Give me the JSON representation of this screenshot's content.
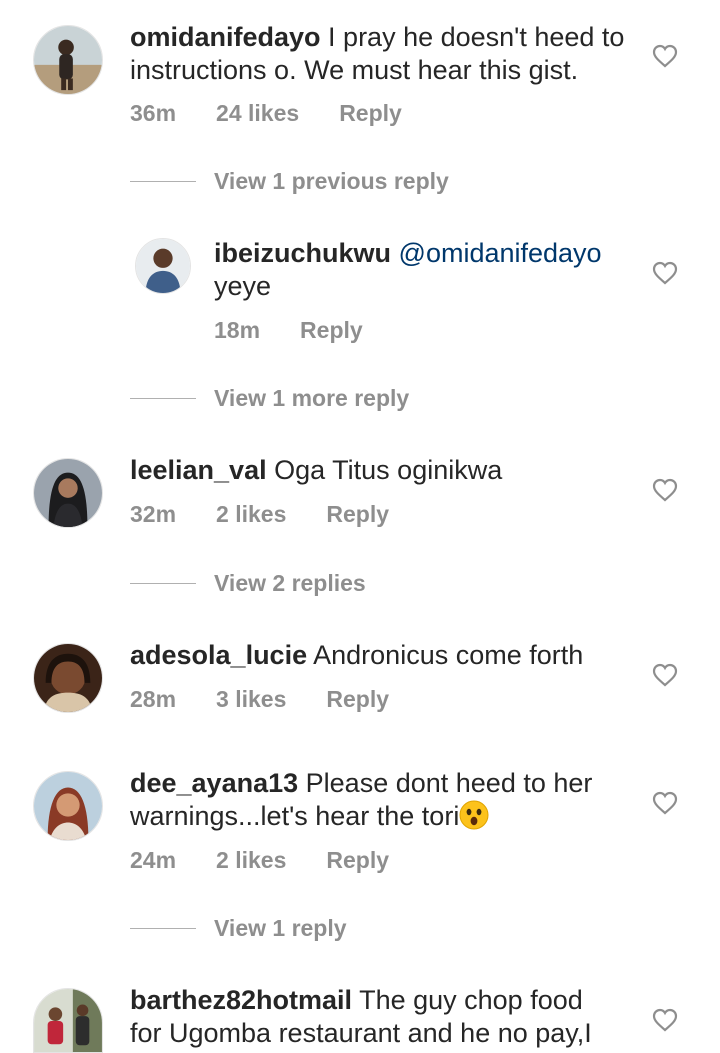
{
  "comments": [
    {
      "username": "omidanifedayo",
      "text_line1": "I pray he doesn't heed to",
      "text_line2": "instructions o. We must hear this gist.",
      "time": "36m",
      "likes": "24 likes",
      "reply": "Reply"
    },
    {
      "username": "ibeizuchukwu",
      "mention": "@omidanifedayo",
      "text": "yeye",
      "time": "18m",
      "reply": "Reply"
    },
    {
      "username": "leelian_val",
      "text": "Oga Titus oginikwa",
      "time": "32m",
      "likes": "2 likes",
      "reply": "Reply"
    },
    {
      "username": "adesola_lucie",
      "text": "Andronicus come forth",
      "time": "28m",
      "likes": "3 likes",
      "reply": "Reply"
    },
    {
      "username": "dee_ayana13",
      "text_line1": "Please dont heed to her",
      "text_line2": "warnings...let's hear the tori",
      "time": "24m",
      "likes": "2 likes",
      "reply": "Reply"
    },
    {
      "username": "barthez82hotmail",
      "text_line1": "The guy chop food",
      "text_line2": "for Ugomba restaurant and he no pay,I"
    }
  ],
  "view_replies": [
    "View 1 previous reply",
    "View 1 more reply",
    "View 2 replies",
    "View 1 reply"
  ],
  "icons": {
    "like": "heart-outline-icon",
    "emoji": "astonished-face-emoji"
  },
  "colors": {
    "text": "#262626",
    "muted": "#8e8e8e",
    "mention": "#00376b"
  }
}
